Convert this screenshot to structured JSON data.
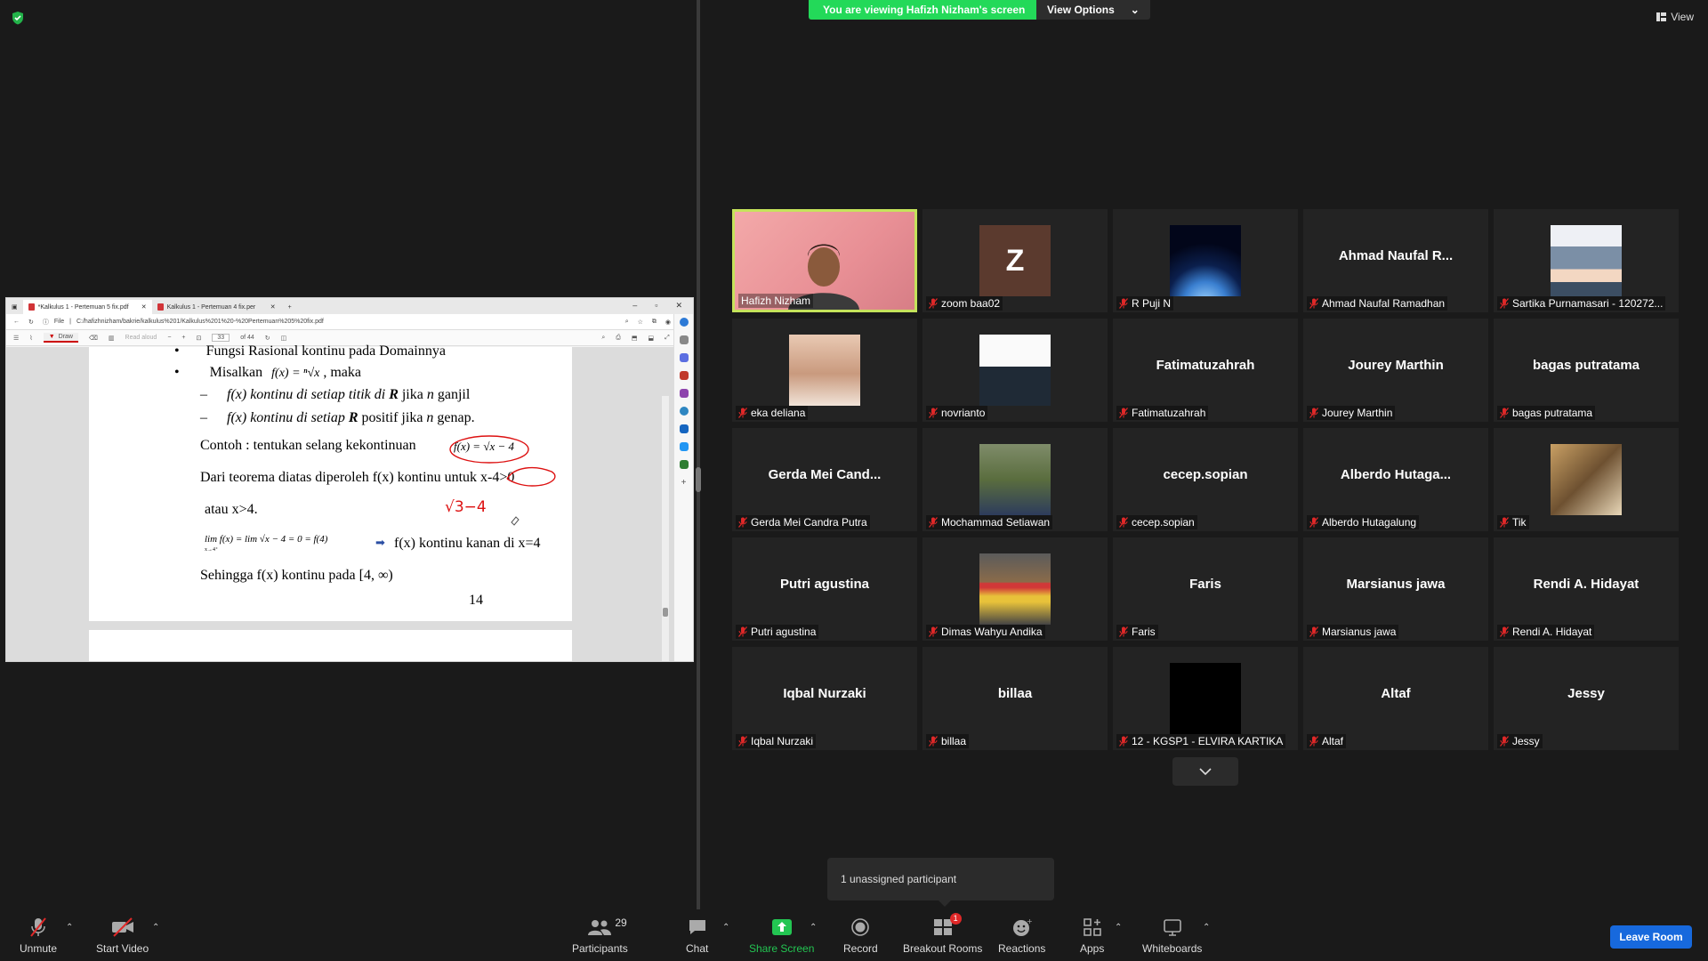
{
  "top": {
    "viewing_banner": "You are viewing Hafizh Nizham's screen",
    "view_options": "View Options",
    "view_label": "View"
  },
  "browser": {
    "tabs": [
      {
        "label": "*Kalkulus 1 - Pertemuan 5 fix.pdf"
      },
      {
        "label": "Kalkulus 1 - Pertemuan 4 fix.per"
      }
    ],
    "address_prefix": "File",
    "url": "C:/hafizhnizham/bakrie/kalkulus%201/Kalkulus%201%20-%20Pertemuan%205%20fix.pdf",
    "draw_label": "Draw",
    "read_aloud": "Read aloud",
    "page_current": "33",
    "page_total": "of 44"
  },
  "slide": {
    "bullet1": "Fungsi Rasional kontinu pada Domainnya",
    "bullet2_pre": "Misalkan",
    "bullet2_formula": "f(x) = ⁿ√x",
    "bullet2_post": ", maka",
    "sub1_a": "f(x) kontinu di setiap titik di ",
    "sub1_b": "R",
    "sub1_c": " jika ",
    "sub1_d": "n",
    "sub1_e": " ganjil",
    "sub2_a": "f(x) kontinu di setiap ",
    "sub2_b": "R",
    "sub2_c": " positif jika ",
    "sub2_d": "n",
    "sub2_e": " genap.",
    "contoh": "Contoh : tentukan selang kekontinuan",
    "contoh_formula": "f(x) = √x − 4",
    "dari": "Dari teorema diatas diperoleh f(x) kontinu untuk x-4>0",
    "atau": "atau x>4.",
    "handwriting": "√3−4",
    "lim": "lim f(x) = lim √x − 4 = 0 = f(4)",
    "lim_sub": "x→4⁺",
    "kanan": "f(x) kontinu kanan di x=4",
    "sehingga": "Sehingga f(x) kontinu pada [4, ∞)",
    "page_no": "14"
  },
  "gallery": {
    "tiles": [
      {
        "name": "Hafizh Nizham",
        "type": "video",
        "muted": false
      },
      {
        "name": "zoom baa02",
        "type": "letter",
        "letter": "Z",
        "muted": true
      },
      {
        "name": "R Puji N",
        "type": "earth",
        "muted": true
      },
      {
        "name": "Ahmad Naufal Ramadhan",
        "type": "text",
        "big": "Ahmad Naufal R...",
        "muted": true
      },
      {
        "name": "Sartika Purnamasari - 120272...",
        "type": "hijab",
        "muted": true
      },
      {
        "name": "eka deliana",
        "type": "photo",
        "muted": true
      },
      {
        "name": "novrianto",
        "type": "photo2",
        "muted": true
      },
      {
        "name": "Fatimatuzahrah",
        "type": "text",
        "big": "Fatimatuzahrah",
        "muted": true
      },
      {
        "name": "Jourey Marthin",
        "type": "text",
        "big": "Jourey Marthin",
        "muted": true
      },
      {
        "name": "bagas putratama",
        "type": "text",
        "big": "bagas putratama",
        "muted": true
      },
      {
        "name": "Gerda Mei Candra Putra",
        "type": "text",
        "big": "Gerda Mei Cand...",
        "muted": true
      },
      {
        "name": "Mochammad Setiawan",
        "type": "photo3",
        "muted": true
      },
      {
        "name": "cecep.sopian",
        "type": "text",
        "big": "cecep.sopian",
        "muted": true
      },
      {
        "name": "Alberdo Hutagalung",
        "type": "text",
        "big": "Alberdo Hutaga...",
        "muted": true
      },
      {
        "name": "Tik",
        "type": "photo4",
        "muted": true
      },
      {
        "name": "Putri agustina",
        "type": "text",
        "big": "Putri agustina",
        "muted": true
      },
      {
        "name": "Dimas Wahyu Andika",
        "type": "photo5",
        "muted": true
      },
      {
        "name": "Faris",
        "type": "text",
        "big": "Faris",
        "muted": true
      },
      {
        "name": "Marsianus jawa",
        "type": "text",
        "big": "Marsianus jawa",
        "muted": true
      },
      {
        "name": "Rendi A. Hidayat",
        "type": "text",
        "big": "Rendi A. Hidayat",
        "muted": true
      },
      {
        "name": "Iqbal Nurzaki",
        "type": "text",
        "big": "Iqbal Nurzaki",
        "muted": true
      },
      {
        "name": "billaa",
        "type": "text",
        "big": "billaa",
        "muted": true
      },
      {
        "name": "12 - KGSP1 - ELVIRA KARTIKA",
        "type": "black",
        "muted": true
      },
      {
        "name": "Altaf",
        "type": "text",
        "big": "Altaf",
        "muted": true
      },
      {
        "name": "Jessy",
        "type": "text",
        "big": "Jessy",
        "muted": true
      }
    ]
  },
  "unassigned": "1 unassigned participant",
  "toolbar": {
    "unmute": "Unmute",
    "start_video": "Start Video",
    "participants": "Participants",
    "participants_count": "29",
    "chat": "Chat",
    "share_screen": "Share Screen",
    "record": "Record",
    "breakout_rooms": "Breakout Rooms",
    "breakout_badge": "1",
    "reactions": "Reactions",
    "apps": "Apps",
    "whiteboards": "Whiteboards",
    "leave": "Leave Room"
  },
  "colors": {
    "banner_green": "#23d959",
    "active_speaker": "#c5e35b",
    "leave_blue": "#1769dd",
    "mute_red": "#e02828"
  }
}
